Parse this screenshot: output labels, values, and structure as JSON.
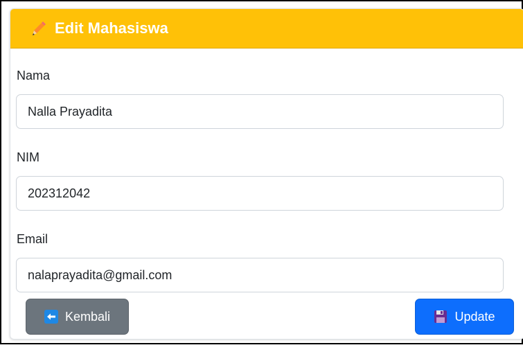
{
  "card": {
    "title": "Edit Mahasiswa",
    "icon": "pencil-icon",
    "header_color": "#ffc107"
  },
  "form": {
    "name_label": "Nama",
    "name_value": "Nalla Prayadita",
    "nim_label": "NIM",
    "nim_value": "202312042",
    "email_label": "Email",
    "email_value": "nalaprayadita@gmail.com"
  },
  "buttons": {
    "back_label": "Kembali",
    "back_icon": "arrow-left-icon",
    "back_color": "#6c757d",
    "update_label": "Update",
    "update_icon": "floppy-disk-icon",
    "update_color": "#0d6efd"
  }
}
